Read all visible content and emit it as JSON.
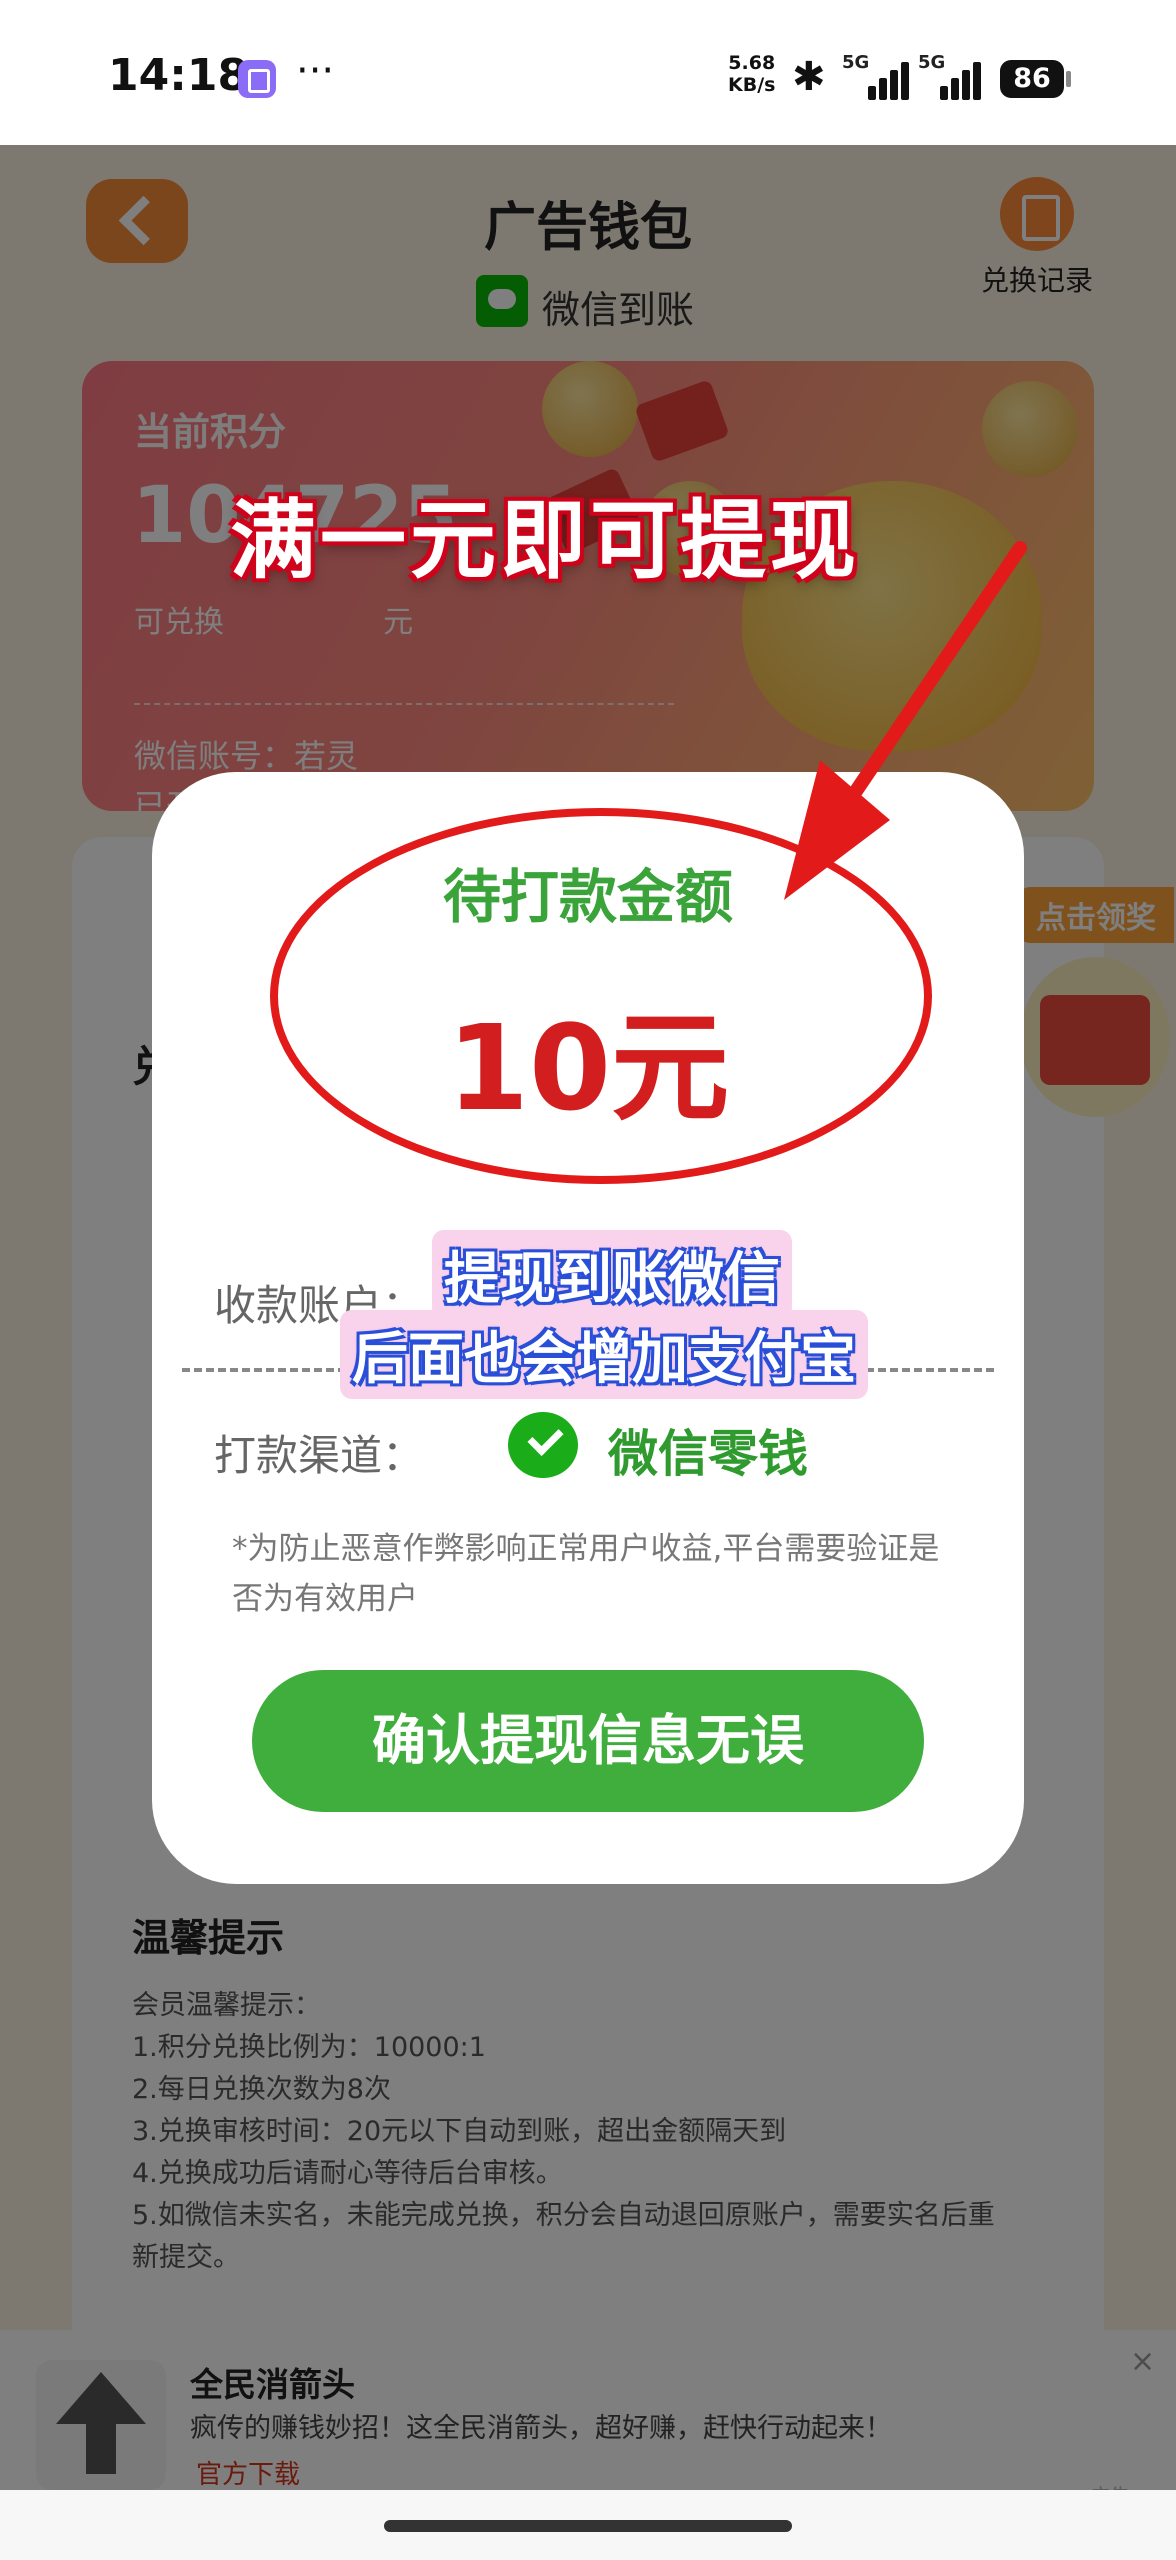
{
  "status_bar": {
    "time": "14:18",
    "speed_value": "5.68",
    "speed_unit": "KB/s",
    "signal1_label": "5G",
    "signal2_label": "5G",
    "battery": "86"
  },
  "header": {
    "title": "广告钱包",
    "payment_label": "微信到账",
    "record_label": "兑换记录"
  },
  "points_card": {
    "label": "当前积分",
    "value": "104725",
    "sub_prefix": "可兑换",
    "sub_suffix": "元",
    "account": "微信账号：若灵",
    "status_partial": "已开"
  },
  "overlay_caption": "满一元即可提现",
  "exchange_section": {
    "title_partial": "兑",
    "reward_tag": "点击领奖"
  },
  "dialog": {
    "title": "待打款金额",
    "amount": "10元",
    "account_label": "收款账户：",
    "channel_label": "打款渠道：",
    "channel_value": "微信零钱",
    "note": "*为防止恶意作弊影响正常用户收益,平台需要验证是否为有效用户",
    "confirm_label": "确认提现信息无误"
  },
  "annotations": {
    "line1": "提现到账微信",
    "line2": "后面也会增加支付宝"
  },
  "tips": {
    "title": "温馨提示",
    "items": [
      "会员温馨提示：",
      "1.积分兑换比例为：10000:1",
      "2.每日兑换次数为8次",
      "3.兑换审核时间：20元以下自动到账，超出金额隔天到",
      "4.兑换成功后请耐心等待后台审核。",
      "5.如微信未实名，未能完成兑换，积分会自动退回原账户，需要实名后重",
      "新提交。"
    ]
  },
  "ad": {
    "title": "全民消箭头",
    "desc": "疯传的赚钱妙招！这全民消箭头，超好赚，赶快行动起来！",
    "link": "官方下载",
    "close": "×",
    "mark": "广告"
  },
  "colors": {
    "primary_green": "#3fae3d",
    "amount_red": "#d21e1e",
    "annotation_red": "#e21a1a"
  }
}
